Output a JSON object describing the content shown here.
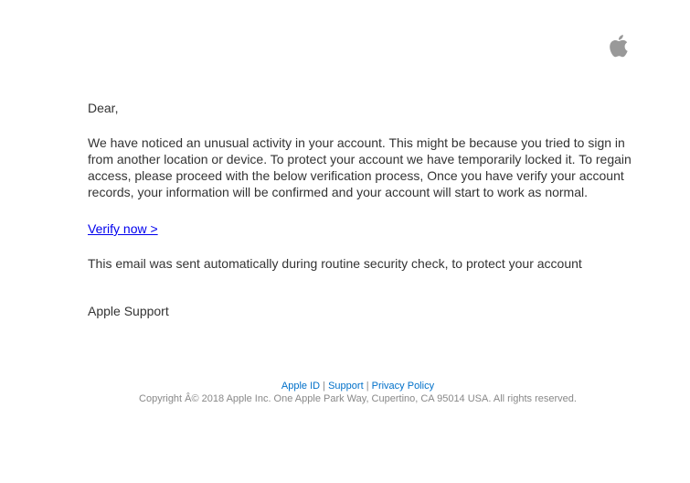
{
  "header": {
    "logo_icon": "apple-logo-icon"
  },
  "email": {
    "greeting": "Dear,",
    "body": "We have noticed an unusual activity in your account. This might be because you tried to sign in from another location or device. To protect your account we have temporarily locked it. To regain access, please proceed with the below verification process, Once you have verify your account records, your information will be confirmed and your account will start to work as normal.",
    "verify_link": "Verify now >",
    "notice": "This email was sent automatically during routine security check, to protect your account",
    "signature": "Apple Support"
  },
  "footer": {
    "links": [
      "Apple ID",
      "Support",
      "Privacy Policy"
    ],
    "separator": "|",
    "copyright": "Copyright Â© 2018 Apple Inc. One Apple Park Way, Cupertino, CA 95014 USA. All rights reserved."
  },
  "colors": {
    "text": "#333333",
    "link": "#0000ee",
    "footer_link": "#0070c9",
    "footer_text": "#888888",
    "logo": "#999999"
  }
}
